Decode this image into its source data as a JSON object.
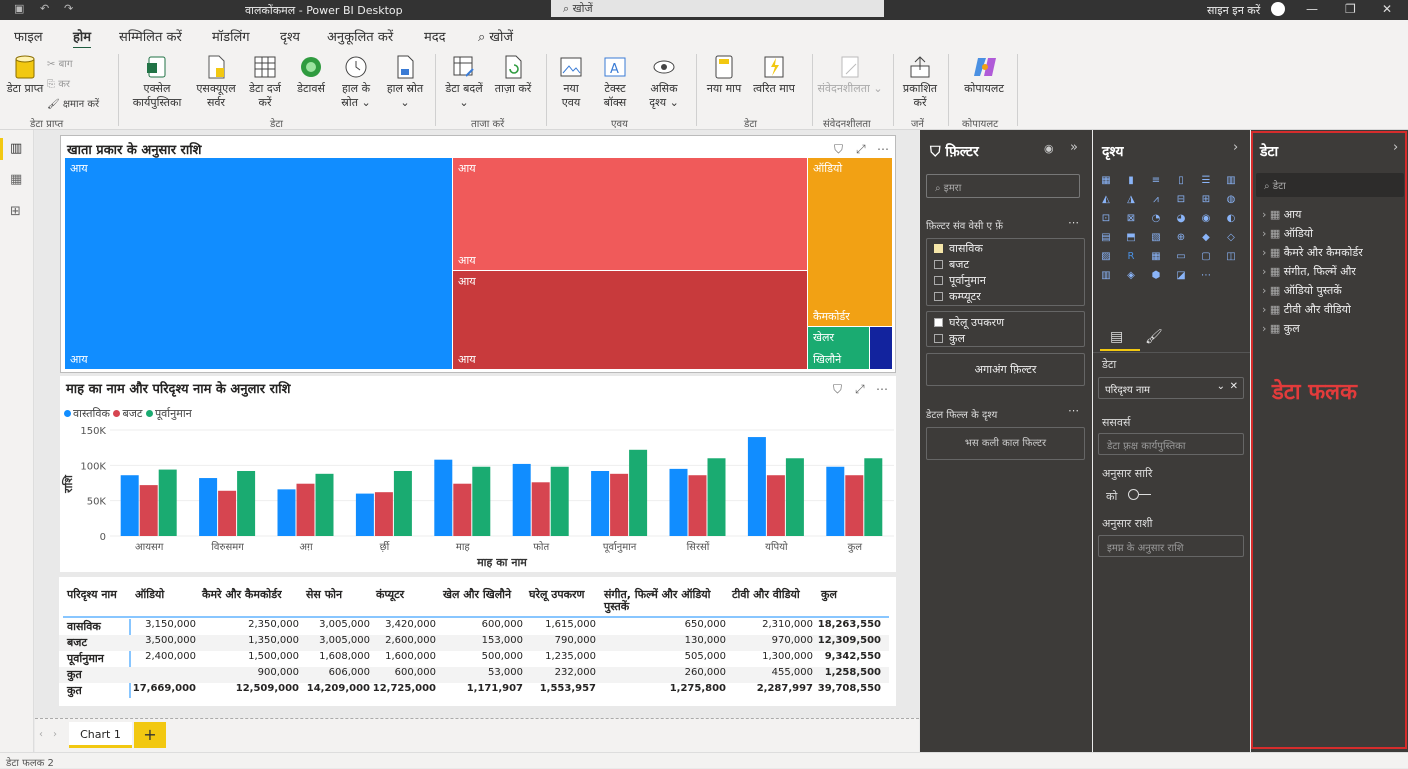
{
  "titlebar": {
    "doc_name": "वालकोंकमल",
    "app_title": "Power BI Desktop",
    "search": "खोजें",
    "signin": "साइन इन करें"
  },
  "menu": [
    "फाइल",
    "होम",
    "सम्मिलित करें",
    "मॉडलिंग",
    "दृश्य",
    "अनुकूलित करें",
    "मदद",
    "खोजें"
  ],
  "ribbon": {
    "buttons": [
      {
        "label": "डेटा प्राप्त"
      },
      {
        "label": "एक्सेल कार्यपुस्तिका"
      },
      {
        "label": "एसक्यूएल सर्वर"
      },
      {
        "label": "डेटा दर्ज करें"
      },
      {
        "label": "डेटावर्स"
      },
      {
        "label": "हाल के स्रोत ⌄"
      },
      {
        "label": "हाल स्रोत ⌄"
      },
      {
        "label": "डेटा बदलें ⌄"
      },
      {
        "label": "ताज़ा करें"
      },
      {
        "label": "नया एवय"
      },
      {
        "label": "टेक्स्ट बॉक्स"
      },
      {
        "label": "असिक दृश्य ⌄"
      },
      {
        "label": "नया माप"
      },
      {
        "label": "त्वरित माप"
      },
      {
        "label": "संवेदनशीलता ⌄"
      },
      {
        "label": "प्रकाशित करें"
      },
      {
        "label": "कोपायलट"
      }
    ],
    "small": [
      "बाग",
      "कर",
      "क्षमान करें"
    ],
    "groups": [
      "डेटा प्राप्त",
      "डेटा",
      "ताजा करें",
      "एवय",
      "डेटा",
      "संवेदनशीलता",
      "जनें",
      "कोपायलट"
    ]
  },
  "treemap": {
    "title": "खाता प्रकार के अनुसार राशि",
    "tiles": [
      {
        "top": "आय",
        "bottom": "आय",
        "color": "#118dff"
      },
      {
        "top": "आय",
        "bottom": "आय",
        "color": "#f05a5a"
      },
      {
        "top": "आय",
        "bottom": "आय",
        "color": "#c83a3c"
      },
      {
        "top": "ऑडियो",
        "bottom": "कैमकोर्डर",
        "color": "#f2a114"
      },
      {
        "top": "खेलर",
        "bottom": "खिलौने",
        "color": "#1aab71"
      },
      {
        "top": "",
        "bottom": "",
        "color": "#12239e"
      }
    ]
  },
  "barchart": {
    "title": "माह का नाम और परिदृश्य नाम के अनुलार राशि",
    "legend": [
      "वास्तविक",
      "बजट",
      "पूर्वानुमान"
    ],
    "xlabel": "माह का नाम",
    "ylabel": "राशि",
    "yticks": [
      "150K",
      "100K",
      "50K",
      "0"
    ]
  },
  "chart_data": {
    "type": "bar",
    "categories": [
      "आयसग",
      "विरुसमग",
      "अग़",
      "र्छ़ी",
      "माह",
      "फोत",
      "पूर्वानुमान",
      "सिरसों",
      "यपियो",
      "कुल"
    ],
    "series": [
      {
        "name": "वास्तविक",
        "values": [
          86000,
          82000,
          66000,
          60000,
          108000,
          102000,
          92000,
          95000,
          140000,
          98000
        ],
        "color": "#118dff"
      },
      {
        "name": "बजट",
        "values": [
          72000,
          64000,
          74000,
          62000,
          74000,
          76000,
          88000,
          86000,
          86000,
          86000
        ],
        "color": "#d64550"
      },
      {
        "name": "पूर्वानुमान",
        "values": [
          94000,
          92000,
          88000,
          92000,
          98000,
          98000,
          122000,
          110000,
          110000,
          110000
        ],
        "color": "#1aab71"
      }
    ],
    "ylim": [
      0,
      150000
    ]
  },
  "table": {
    "headers": [
      "परिदृश्य नाम",
      "ऑडियो",
      "कैमरे और कैमकोर्डर",
      "सेस फोन",
      "कंप्यूटर",
      "खेल और खिलौने",
      "घरेलू उपकरण",
      "संगीत, फिल्में और ऑडियो पुस्तकें",
      "टीवी और वीडियो",
      "कुल"
    ],
    "rows": [
      {
        "name": "वासविक",
        "cells": [
          "3,150,000",
          "2,350,000",
          "3,005,000",
          "3,420,000",
          "600,000",
          "1,615,000",
          "650,000",
          "2,310,000",
          "18,263,550"
        ]
      },
      {
        "name": "बजट",
        "cells": [
          "3,500,000",
          "1,350,000",
          "3,005,000",
          "2,600,000",
          "153,000",
          "790,000",
          "130,000",
          "970,000",
          "12,309,500"
        ]
      },
      {
        "name": "पूर्वानुमान",
        "cells": [
          "2,400,000",
          "1,500,000",
          "1,608,000",
          "1,600,000",
          "500,000",
          "1,235,000",
          "505,000",
          "1,300,000",
          "9,342,550"
        ]
      },
      {
        "name": "कुत",
        "cells": [
          "",
          "900,000",
          "606,000",
          "600,000",
          "53,000",
          "232,000",
          "260,000",
          "455,000",
          "1,258,500"
        ]
      },
      {
        "name": "कुत",
        "cells": [
          "17,669,000",
          "12,509,000",
          "14,209,000",
          "12,725,000",
          "1,171,907",
          "1,553,957",
          "1,275,800",
          "2,287,997",
          "39,708,550"
        ]
      }
    ]
  },
  "pages": {
    "tab": "Chart 1",
    "add": "+"
  },
  "status": "डेटा फलक 2",
  "filters": {
    "title": "फ़िल्टर",
    "search": "इमरा",
    "section": "फ़िल्टर संव वेसी ए फ़ें",
    "items": [
      "वासविक",
      "बजट",
      "पूर्वानुमान",
      "कम्प्यूटर"
    ],
    "items2": [
      "घरेलू उपकरण",
      "कुल"
    ],
    "add_button": "अगाअंग फ़िल्टर",
    "drill": "डेटल फिल्ल के दृश्य",
    "drill_box": "भस कली काल फिल्टर"
  },
  "viz": {
    "title": "दृश्य",
    "data_label": "डेटा",
    "field": "परिदृश्य नाम",
    "sec1": "ससवर्स",
    "sec1_box": "डेटा फ़्रक्ष कार्यपुस्तिका",
    "sec2": "अनुसार सारि",
    "toggle_label": "को",
    "sec3": "अनुसार राशी",
    "sec3_box": "इमप्न के अनुसार राशि"
  },
  "datapane": {
    "title": "डेटा",
    "search": "डेटा",
    "items": [
      "आय",
      "ऑडियो",
      "कैमरे और कैमकोर्डर",
      "संगीत, फिल्में और",
      "ऑडियो पुस्तकें",
      "टीवी और वीडियो",
      "कुल"
    ],
    "annotation": "डेटा फलक"
  }
}
